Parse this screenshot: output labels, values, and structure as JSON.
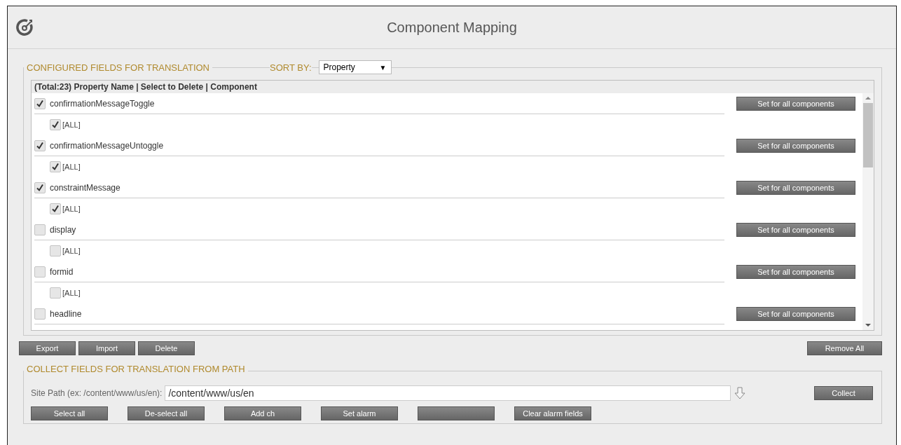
{
  "window": {
    "title": "Component Mapping"
  },
  "configured": {
    "legend": "CONFIGURED FIELDS FOR TRANSLATION",
    "sort_label": "SORT BY:",
    "sort_value": "Property",
    "sort_caret": "▼",
    "header": "(Total:23) Property Name | Select to Delete | Component",
    "properties": [
      {
        "name": "confirmationMessageToggle",
        "set_button": "Set for all components",
        "checked": true,
        "all_label": "[ALL]",
        "all_checked": true
      },
      {
        "name": "confirmationMessageUntoggle",
        "set_button": "Set for all components",
        "checked": true,
        "all_label": "[ALL]",
        "all_checked": true
      },
      {
        "name": "constraintMessage",
        "set_button": "Set for all components",
        "checked": true,
        "all_label": "[ALL]",
        "all_checked": true
      },
      {
        "name": "display",
        "set_button": "Set for all components",
        "checked": false,
        "all_label": "[ALL]",
        "all_checked": false
      },
      {
        "name": "formid",
        "set_button": "Set for all components",
        "checked": false,
        "all_label": "[ALL]",
        "all_checked": false
      },
      {
        "name": "headline",
        "set_button": "Set for all components",
        "checked": false
      }
    ],
    "actions": [
      "Export",
      "Import",
      "Delete"
    ],
    "remove_all": "Remove All"
  },
  "collect": {
    "legend": "COLLECT FIELDS FOR TRANSLATION FROM PATH",
    "path_label": "Site Path (ex: /content/www/us/en):",
    "path_value": "/content/www/us/en",
    "collect_button": "Collect",
    "buttons": [
      {
        "kind": "labeled",
        "label": "Select all"
      },
      {
        "kind": "labeled",
        "label": "De-select all"
      },
      {
        "kind": "labeled",
        "label": "Add ch"
      },
      {
        "kind": "labeled",
        "label": "Set alarm"
      },
      {
        "kind": "blank"
      },
      {
        "kind": "labeled",
        "label": "Clear alarm fields"
      }
    ]
  }
}
